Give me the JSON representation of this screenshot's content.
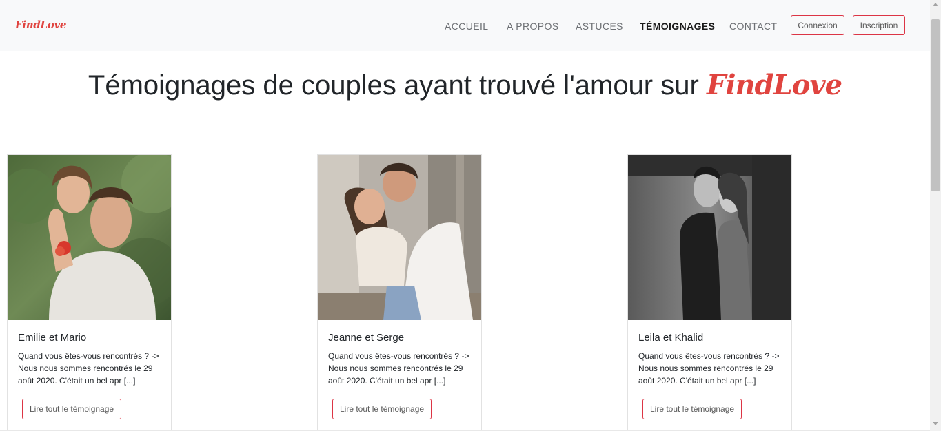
{
  "navbar": {
    "brand": "FindLove",
    "items": [
      {
        "label": "ACCUEIL",
        "active": false
      },
      {
        "label": "A PROPOS",
        "active": false
      },
      {
        "label": "ASTUCES",
        "active": false
      },
      {
        "label": "TÉMOIGNAGES",
        "active": true
      },
      {
        "label": "CONTACT",
        "active": false
      }
    ],
    "login_label": "Connexion",
    "signup_label": "Inscription"
  },
  "header": {
    "title": "Témoignages de couples ayant trouvé l'amour sur",
    "brand": "FindLove"
  },
  "colors": {
    "accent": "#e0443f",
    "button_border": "#dc3545",
    "navbar_bg": "#f8f9fa"
  },
  "testimonials": [
    {
      "names": "Emilie et Mario",
      "excerpt": "Quand vous êtes-vous rencontrés ? -> Nous nous sommes rencontrés le 29 août 2020. C'était un bel apr [...]",
      "button": "Lire tout le témoignage",
      "photo": "couple-photo-color-outdoor"
    },
    {
      "names": "Jeanne et Serge",
      "excerpt": "Quand vous êtes-vous rencontrés ? -> Nous nous sommes rencontrés le 29 août 2020. C'était un bel apr [...]",
      "button": "Lire tout le témoignage",
      "photo": "couple-photo-indoor-hug"
    },
    {
      "names": "Leila et Khalid",
      "excerpt": "Quand vous êtes-vous rencontrés ? -> Nous nous sommes rencontrés le 29 août 2020. C'était un bel apr [...]",
      "button": "Lire tout le témoignage",
      "photo": "couple-photo-black-white"
    }
  ]
}
